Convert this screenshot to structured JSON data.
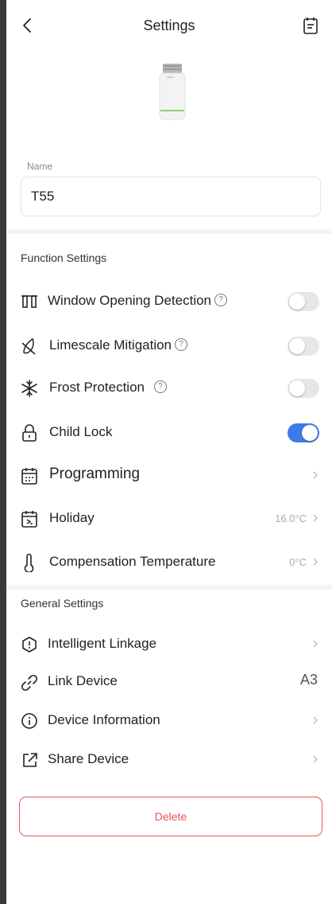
{
  "header": {
    "title": "Settings"
  },
  "name_section": {
    "label": "Name",
    "value": "T55"
  },
  "function_settings": {
    "title": "Function Settings",
    "window_opening": {
      "label": "Window Opening Detection",
      "help": "?",
      "enabled": false
    },
    "limescale": {
      "label": "Limescale Mitigation",
      "help": "?",
      "enabled": false
    },
    "frost": {
      "label": "Frost Protection",
      "help": "?",
      "enabled": false
    },
    "child_lock": {
      "label": "Child Lock",
      "enabled": true
    },
    "programming": {
      "label": "Programming"
    },
    "holiday": {
      "label": "Holiday",
      "value": "16.0°C"
    },
    "compensation": {
      "label": "Compensation Temperature",
      "value": "0°C"
    }
  },
  "general_settings": {
    "title": "General Settings",
    "intelligent_linkage": {
      "label": "Intelligent Linkage"
    },
    "link_device": {
      "label": "Link Device",
      "value": "A3"
    },
    "device_information": {
      "label": "Device Information"
    },
    "share_device": {
      "label": "Share Device"
    }
  },
  "delete_button": {
    "label": "Delete"
  },
  "colors": {
    "accent": "#3d7be8",
    "danger": "#e8545a",
    "toggle_off": "#e6e6e6"
  }
}
